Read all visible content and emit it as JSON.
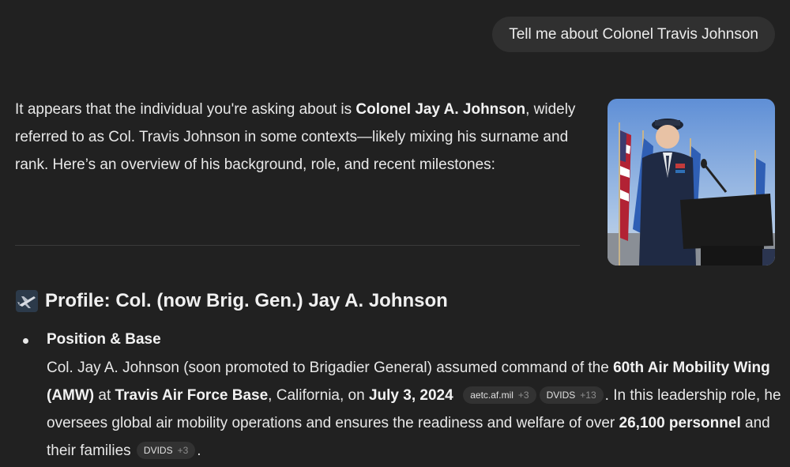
{
  "user_message": "Tell me about Colonel Travis Johnson",
  "intro": {
    "part1": "It appears that the individual you're asking about is ",
    "bold1": "Colonel Jay A. Johnson",
    "part2": ", widely referred to as Col. Travis Johnson in some contexts—likely mixing his surname and rank. Here’s an overview of his background, role, and recent milestones:"
  },
  "section": {
    "icon": "airplane-icon",
    "title": "Profile: Col. (now Brig. Gen.) Jay A. Johnson"
  },
  "bullet": {
    "title": "Position & Base",
    "t1": "Col. Jay A. Johnson (soon promoted to Brigadier General) assumed command of the ",
    "b1": "60th Air Mobility Wing (AMW)",
    "t2": " at ",
    "b2": "Travis Air Force Base",
    "t3": ", California, on ",
    "b3": "July 3, 2024",
    "cite1": {
      "source": "aetc.af.mil",
      "count": "+3"
    },
    "cite2": {
      "source": "DVIDS",
      "count": "+13"
    },
    "t4": ". In this leadership role, he oversees global air mobility operations and ensures the readiness and welfare of over ",
    "b4": "26,100 personnel",
    "t5": " and their families ",
    "cite3": {
      "source": "DVIDS",
      "count": "+3"
    },
    "t6": "."
  },
  "colors": {
    "background": "#212121",
    "bubble": "#303030",
    "cite_pill": "#323232"
  }
}
